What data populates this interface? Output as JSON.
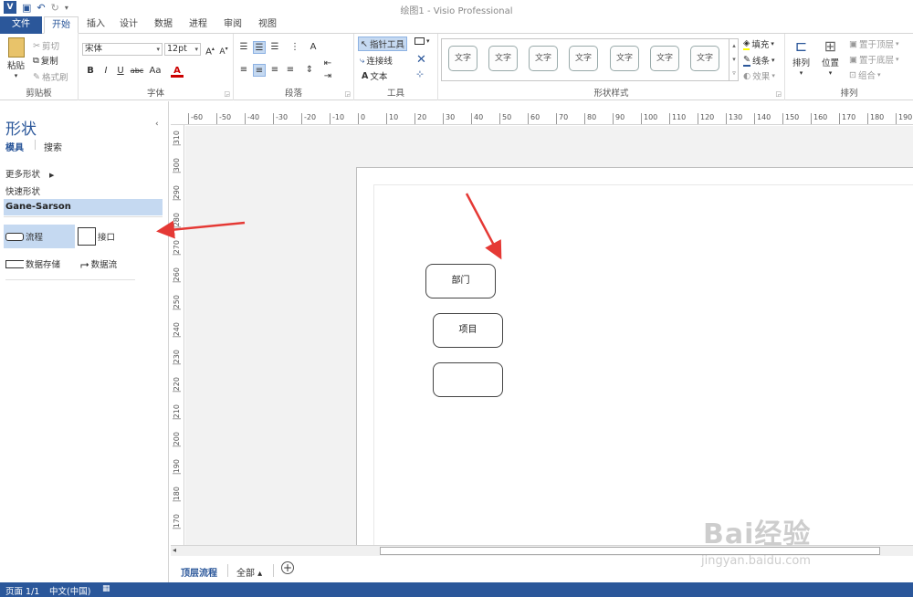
{
  "titlebar": {
    "app_title": "绘图1 - Visio Professional",
    "logo": "V"
  },
  "tabs": [
    "文件",
    "开始",
    "插入",
    "设计",
    "数据",
    "进程",
    "审阅",
    "视图"
  ],
  "ribbon": {
    "clipboard": {
      "label": "剪贴板",
      "paste": "粘贴",
      "cut": "剪切",
      "copy": "复制",
      "format_painter": "格式刷"
    },
    "font": {
      "label": "字体",
      "font_name": "宋体",
      "font_size": "12pt",
      "bold": "B",
      "italic": "I",
      "underline": "U",
      "strike": "abc",
      "case": "Aa",
      "color": "A"
    },
    "paragraph": {
      "label": "段落"
    },
    "tools": {
      "label": "工具",
      "pointer": "指针工具",
      "connector": "连接线",
      "text": "文本"
    },
    "shape_styles": {
      "label": "形状样式",
      "items": [
        "文字",
        "文字",
        "文字",
        "文字",
        "文字",
        "文字",
        "文字"
      ],
      "fill": "填充",
      "line": "线条",
      "effects": "效果"
    },
    "arrange": {
      "label": "排列",
      "arrange": "排列",
      "position": "位置",
      "bring_front": "置于顶层",
      "send_back": "置于底层",
      "group": "组合"
    }
  },
  "shapes_panel": {
    "title": "形状",
    "tab_stencils": "模具",
    "tab_search": "搜索",
    "more_shapes": "更多形状",
    "quick_shapes": "快速形状",
    "stencil": "Gane-Sarson",
    "items": [
      "流程",
      "接口",
      "数据存储",
      "数据流"
    ]
  },
  "rulers": {
    "h": [
      "-60",
      "-50",
      "-40",
      "-30",
      "-20",
      "-10",
      "0",
      "10",
      "20",
      "30",
      "40",
      "50",
      "60",
      "70",
      "80",
      "90",
      "100",
      "110",
      "120",
      "130",
      "140",
      "150",
      "160",
      "170",
      "180",
      "190"
    ],
    "v": [
      "310",
      "300",
      "290",
      "280",
      "270",
      "260",
      "250",
      "240",
      "230",
      "220",
      "210",
      "200",
      "190",
      "180",
      "170"
    ]
  },
  "canvas": {
    "shapes": [
      "部门",
      "项目",
      ""
    ]
  },
  "page_tabs": {
    "page1": "顶层流程",
    "all": "全部 ▴"
  },
  "status": {
    "page": "页面 1/1",
    "lang": "中文(中国)"
  },
  "watermark": {
    "brand": "Bai经验",
    "url": "jingyan.baidu.com"
  },
  "colors": {
    "accent": "#2b579a",
    "selection": "#c5d9f1",
    "arrow": "#e53935"
  }
}
